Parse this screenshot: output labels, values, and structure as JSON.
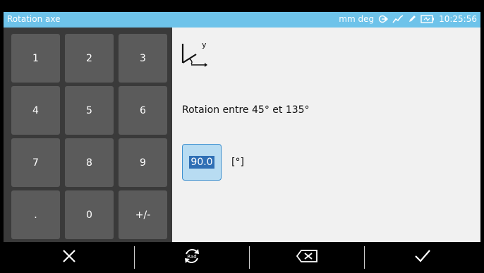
{
  "window": {
    "title": "Rotation axe",
    "status": {
      "units": "mm deg",
      "time": "10:25:56",
      "icons": [
        "login-arrow-icon",
        "chart-line-icon",
        "edit-pen-icon",
        "battery-icon"
      ]
    }
  },
  "keypad": {
    "keys": [
      "1",
      "2",
      "3",
      "4",
      "5",
      "6",
      "7",
      "8",
      "9",
      ".",
      "0",
      "+/-"
    ]
  },
  "content": {
    "axis_icon": "rotation-axis-icon",
    "axis_label": "y",
    "range_text": "Rotaion entre 45° et 135°",
    "angle_value": "90.0",
    "unit": "[°]"
  },
  "bottom_bar": {
    "buttons": [
      "cancel-icon",
      "rad-refresh-icon",
      "backspace-icon",
      "confirm-check-icon"
    ],
    "rad_label": "Rad"
  },
  "colors": {
    "titlebar": "#6ec3ea",
    "keypad_bg": "#3a3a3a",
    "key_bg": "#5b5b5b",
    "content_bg": "#f1f1f1",
    "input_bg": "#b8dcf2",
    "selection": "#2f6fb5"
  }
}
